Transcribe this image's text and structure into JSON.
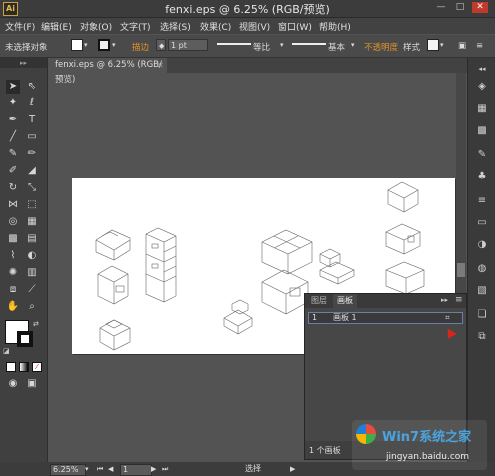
{
  "window": {
    "logo": "Ai",
    "title": "fenxi.eps @ 6.25% (RGB/预览)",
    "controls": [
      "—",
      "□",
      "✕"
    ]
  },
  "menu": [
    {
      "label": "文件(F)"
    },
    {
      "label": "编辑(E)"
    },
    {
      "label": "对象(O)"
    },
    {
      "label": "文字(T)"
    },
    {
      "label": "选择(S)"
    },
    {
      "label": "效果(C)"
    },
    {
      "label": "视图(V)"
    },
    {
      "label": "窗口(W)"
    },
    {
      "label": "帮助(H)"
    }
  ],
  "control_bar": {
    "selection_status": "未选择对象",
    "stroke_label": "描边",
    "stroke_weight": "1 pt",
    "profile_label": "等比",
    "brush_label": "基本",
    "opacity_label": "不透明度",
    "style_label": "样式",
    "accent_color": "#e0932b"
  },
  "document": {
    "tab_label": "fenxi.eps @ 6.25% (RGB/预览)",
    "tab_close": "✕"
  },
  "panel": {
    "tabs": [
      "图层",
      "画板"
    ],
    "active_tab": "画板",
    "artboards": [
      {
        "index": "1",
        "name": "画板 1"
      }
    ],
    "footer_count": "1 个画板"
  },
  "status_bar": {
    "zoom": "6.25%",
    "artboard_number": "1",
    "tool_status": "选择"
  },
  "watermark": {
    "text": "Win7系统之家",
    "url": "jingyan.baidu.com",
    "color": "#4aa3df"
  }
}
